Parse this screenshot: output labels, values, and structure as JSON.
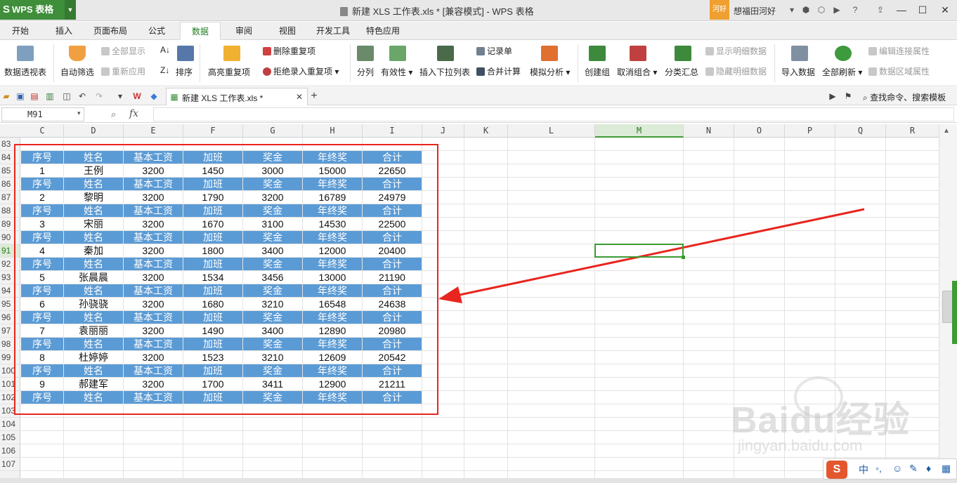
{
  "app": {
    "name": "WPS 表格",
    "document_title": "新建 XLS 工作表.xls * [兼容模式] - WPS 表格",
    "user_badge": "河好",
    "user_name": "想福田河好"
  },
  "menu_tabs": [
    "开始",
    "插入",
    "页面布局",
    "公式",
    "数据",
    "审阅",
    "视图",
    "开发工具",
    "特色应用"
  ],
  "active_menu_tab": "数据",
  "ribbon": {
    "pivot": "数据透视表",
    "autofilter": "自动筛选",
    "show_all": "全部显示",
    "reapply": "重新应用",
    "sort": "排序",
    "highlight_dup": "高亮重复项",
    "remove_dup": "删除重复项",
    "reject_dup": "拒绝录入重复项",
    "split_col": "分列",
    "validity": "有效性",
    "dropdown_list": "插入下拉列表",
    "record_form": "记录单",
    "consolidate": "合并计算",
    "what_if": "模拟分析",
    "group": "创建组",
    "ungroup": "取消组合",
    "subtotal": "分类汇总",
    "show_detail": "显示明细数据",
    "hide_detail": "隐藏明细数据",
    "import_data": "导入数据",
    "refresh_all": "全部刷新",
    "edit_conn": "编辑连接属性",
    "range_props": "数据区域属性"
  },
  "doc_tab": {
    "label": "新建 XLS 工作表.xls *"
  },
  "search_command": "查找命令、搜索模板",
  "formula_bar": {
    "name_box": "M91",
    "fx": "fx",
    "value": ""
  },
  "columns": [
    "C",
    "D",
    "E",
    "F",
    "G",
    "H",
    "I",
    "J",
    "K",
    "L",
    "M",
    "N",
    "O",
    "P",
    "Q",
    "R"
  ],
  "selected_column": "M",
  "rows": [
    "83",
    "84",
    "85",
    "86",
    "87",
    "88",
    "89",
    "90",
    "91",
    "92",
    "93",
    "94",
    "95",
    "96",
    "97",
    "98",
    "99",
    "100",
    "101",
    "102",
    "103",
    "104",
    "105",
    "106",
    "107"
  ],
  "selected_row": "91",
  "table_header": [
    "序号",
    "姓名",
    "基本工资",
    "加班",
    "奖金",
    "年终奖",
    "合计"
  ],
  "table_records": [
    [
      "1",
      "王例",
      "3200",
      "1450",
      "3000",
      "15000",
      "22650"
    ],
    [
      "2",
      "黎明",
      "3200",
      "1790",
      "3200",
      "16789",
      "24979"
    ],
    [
      "3",
      "宋丽",
      "3200",
      "1670",
      "3100",
      "14530",
      "22500"
    ],
    [
      "4",
      "秦加",
      "3200",
      "1800",
      "3400",
      "12000",
      "20400"
    ],
    [
      "5",
      "张晨晨",
      "3200",
      "1534",
      "3456",
      "13000",
      "21190"
    ],
    [
      "6",
      "孙骁骁",
      "3200",
      "1680",
      "3210",
      "16548",
      "24638"
    ],
    [
      "7",
      "袁丽丽",
      "3200",
      "1490",
      "3400",
      "12890",
      "20980"
    ],
    [
      "8",
      "杜婷婷",
      "3200",
      "1523",
      "3210",
      "12609",
      "20542"
    ],
    [
      "9",
      "郝建军",
      "3200",
      "1700",
      "3411",
      "12900",
      "21211"
    ]
  ],
  "ime": {
    "logo": "S",
    "lang": "中"
  },
  "watermark": {
    "text": "Baidu经验",
    "url": "jingyan.baidu.com"
  },
  "colors": {
    "header_fill": "#5b9bd5",
    "annotation_red": "#e8251e",
    "wps_green": "#3e8e3a"
  }
}
